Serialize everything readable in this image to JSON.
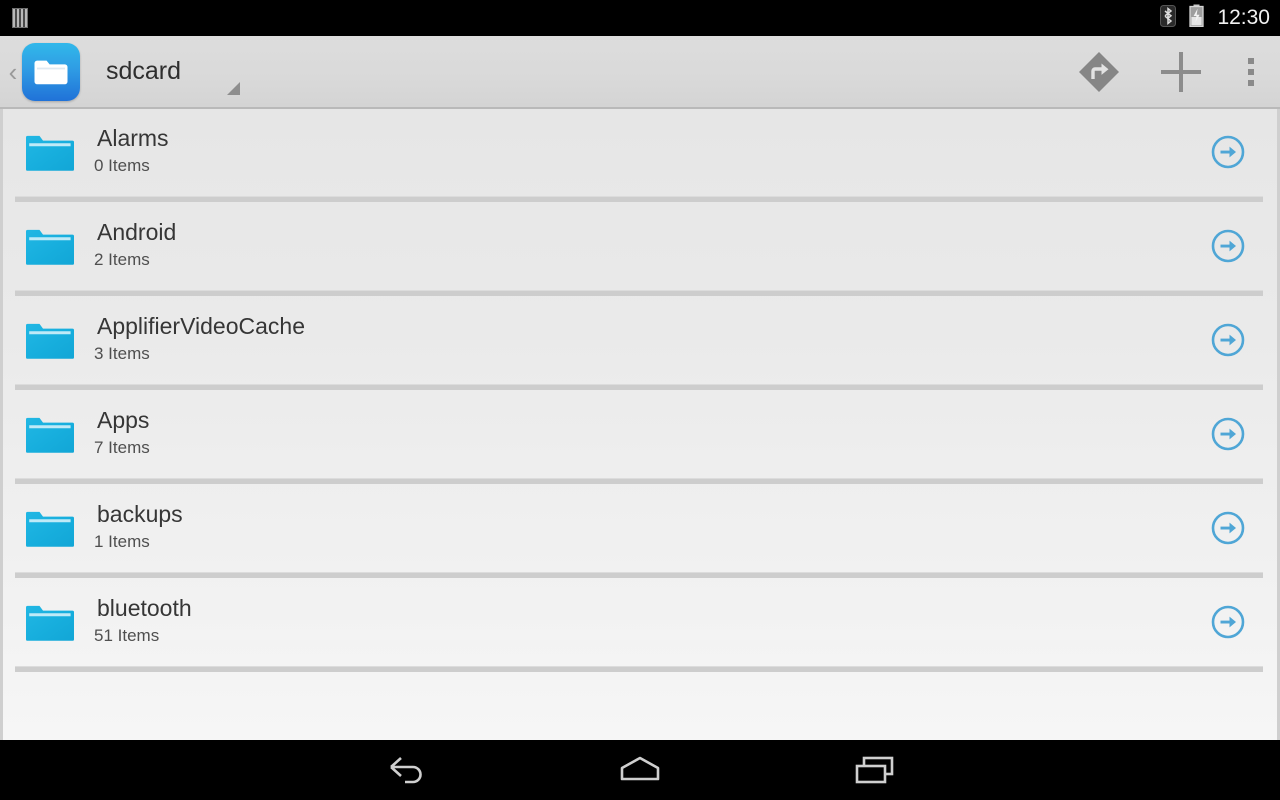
{
  "status_bar": {
    "sim_icon": "sim-card-icon",
    "bluetooth_icon": "bluetooth-icon",
    "battery_icon": "battery-charging-icon",
    "time": "12:30"
  },
  "action_bar": {
    "up_chevron": "‹",
    "app_icon": "folder-app-icon",
    "title": "sdcard",
    "dropdown_indicator": "dropdown-triangle-icon",
    "actions": [
      {
        "name": "navigate-button",
        "icon": "turn-right-diamond-icon"
      },
      {
        "name": "add-button",
        "icon": "plus-icon"
      },
      {
        "name": "overflow-menu-button",
        "icon": "three-dots-icon"
      }
    ]
  },
  "file_list": {
    "go_icon": "circle-arrow-right-icon",
    "folder_icon": "folder-icon",
    "items": [
      {
        "name": "Alarms",
        "count": "0 Items"
      },
      {
        "name": "Android",
        "count": "2 Items"
      },
      {
        "name": "ApplifierVideoCache",
        "count": "3 Items"
      },
      {
        "name": "Apps",
        "count": "7 Items"
      },
      {
        "name": "backups",
        "count": "1 Items"
      },
      {
        "name": "bluetooth",
        "count": "51 Items"
      }
    ]
  },
  "nav_bar": {
    "buttons": [
      {
        "name": "back-button",
        "icon": "back-arrow-icon"
      },
      {
        "name": "home-button",
        "icon": "home-icon"
      },
      {
        "name": "recents-button",
        "icon": "recent-apps-icon"
      }
    ]
  },
  "colors": {
    "accent_blue": "#4fa6d6",
    "folder_cyan": "#22b4e0",
    "app_icon_blue": "#2f9ce4",
    "action_bar_gray": "#d9d9d9",
    "list_gray": "#eaeaea"
  }
}
